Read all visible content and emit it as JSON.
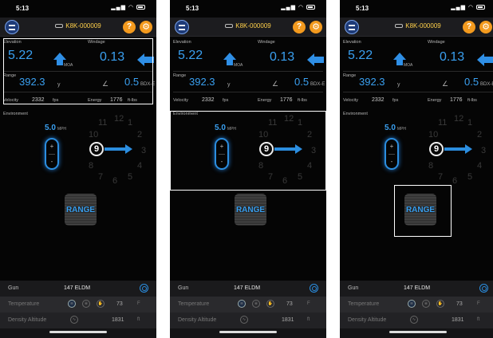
{
  "screens": [
    {
      "time": "5:13",
      "device": "K8K-000009",
      "labels": {
        "elevation": "Elevation",
        "windage": "Windage",
        "range": "Range",
        "environment": "Environment"
      },
      "elevation": {
        "value": "5.22",
        "unit": "MOA"
      },
      "windage": {
        "value": "0.13"
      },
      "range": {
        "value": "392.3",
        "unit": "y"
      },
      "angle": {
        "value": "0.5",
        "unit": "BDX-E"
      },
      "velocity": {
        "label": "Velocity",
        "value": "2332",
        "unit": "fps"
      },
      "energy": {
        "label": "Energy",
        "value": "1776",
        "unit": "ft-lbs"
      },
      "wind": {
        "value": "5.0",
        "unit": "MPH",
        "plus": "+",
        "minus": "-"
      },
      "clock": {
        "center": "9",
        "hours": [
          "12",
          "1",
          "2",
          "3",
          "4",
          "5",
          "6",
          "7",
          "8",
          "10",
          "11"
        ]
      },
      "range_button": "RANGE",
      "gun": {
        "label": "Gun",
        "value": "147 ELDM"
      },
      "temperature": {
        "label": "Temperature",
        "value": "73",
        "unit": "F"
      },
      "density_altitude": {
        "label": "Density Altitude",
        "value": "1831",
        "unit": "ft"
      }
    }
  ],
  "highlight": [
    "top-panel",
    "environment",
    "range-button"
  ]
}
